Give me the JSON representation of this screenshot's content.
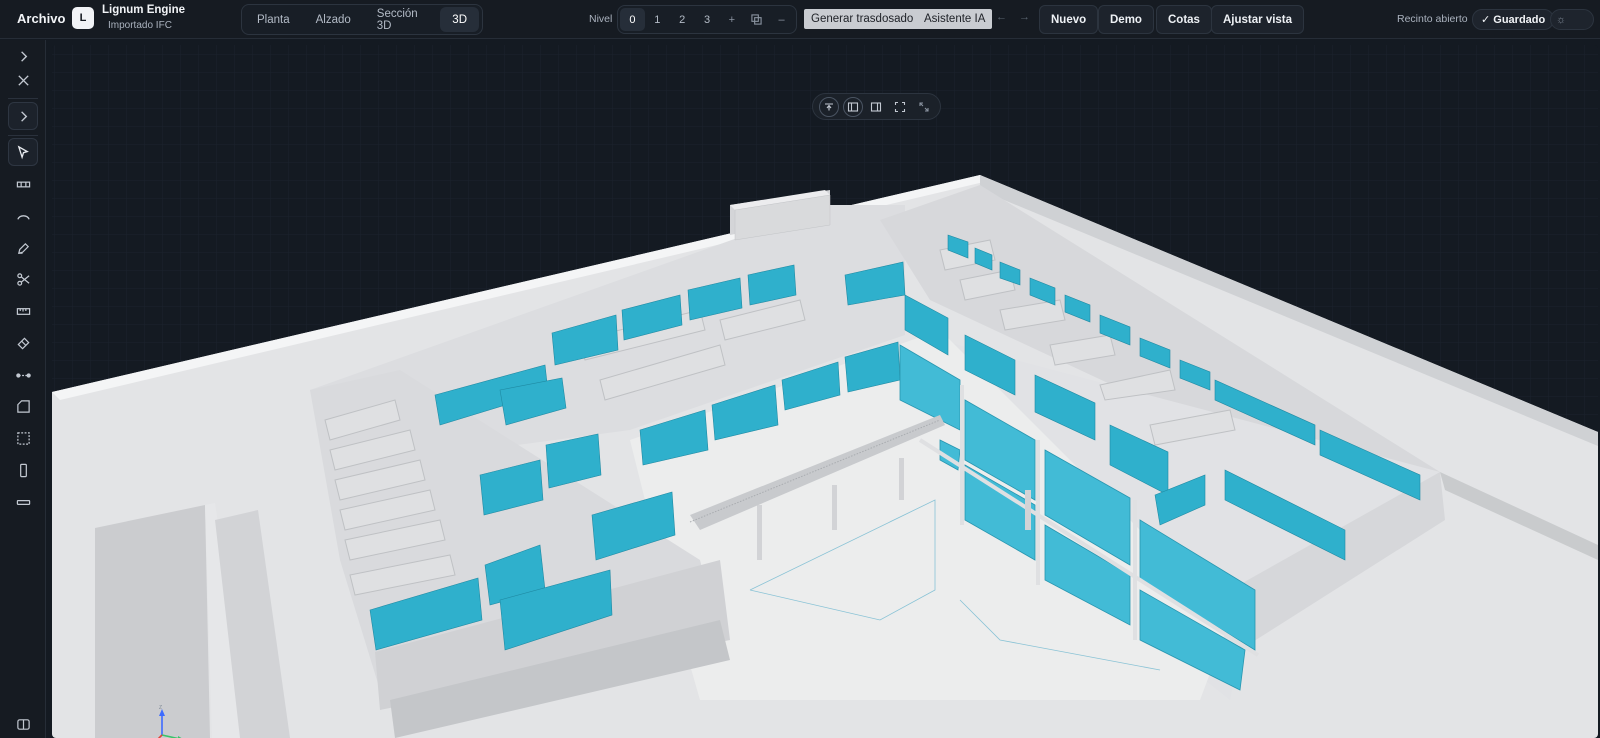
{
  "header": {
    "menu_file": "Archivo",
    "logo_letter": "L",
    "app_name": "Lignum Engine",
    "app_subtitle": "Importado IFC",
    "views": [
      "Planta",
      "Alzado",
      "Sección 3D",
      "3D"
    ],
    "active_view": "3D",
    "level_label": "Nivel",
    "levels": [
      "0",
      "1",
      "2",
      "3"
    ],
    "active_level": "0",
    "level_add": "+",
    "level_remove": "–",
    "generate_label": "Generar trasdosado",
    "assistant_label": "Asistente IA",
    "undo_symbol": "←",
    "redo_symbol": "→",
    "new_label": "Nuevo",
    "demo_label": "Demo",
    "dimensions_label": "Cotas",
    "fit_view_label": "Ajustar vista",
    "enclosure_status": "Recinto abierto",
    "saved_label": "✓ Guardado"
  },
  "toolbar_icons": [
    "expand-icon",
    "close-icon",
    "expand-panel-icon",
    "select-cursor-icon",
    "wall-icon",
    "arc-icon",
    "pen-icon",
    "scissors-icon",
    "ruler-icon",
    "eraser-icon",
    "measure-line-icon",
    "room-icon",
    "area-select-icon",
    "door-icon",
    "window-icon",
    "layers-icon"
  ],
  "viewport_tools": [
    "top-view-icon",
    "split-view-icon",
    "panel-view-icon",
    "fullscreen-icon",
    "fit-icon"
  ],
  "axes": {
    "x": "X",
    "y": "Y",
    "z": "Z"
  },
  "colors": {
    "glass": "#2fb0cc",
    "wall": "#e8e9eb",
    "background": "#141a22",
    "topbar": "#161b22"
  }
}
